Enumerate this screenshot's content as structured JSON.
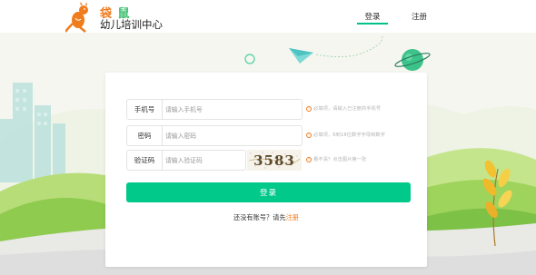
{
  "header": {
    "brand_a": "袋",
    "brand_b": "鼠",
    "subtitle": "幼儿培训中心",
    "nav": {
      "login": "登录",
      "register": "注册"
    }
  },
  "form": {
    "phone": {
      "label": "手机号",
      "placeholder": "请输入手机号",
      "hint": "必填项，请输入已注册的手机号"
    },
    "password": {
      "label": "密码",
      "placeholder": "请输入密码",
      "hint": "必填项，6到18位数字字母和数字"
    },
    "code": {
      "label": "验证码",
      "placeholder": "请输入验证码",
      "captcha_text": "3583",
      "hint": "看不清？点击图片换一张"
    },
    "submit_label": "登录",
    "footer_text": "还没有账号？请先",
    "footer_link": "注册"
  },
  "colors": {
    "primary": "#00c98a",
    "accent": "#f07c1e",
    "sky": "#f7f7f2"
  },
  "icons": {
    "warning": "exclamation-circle-icon"
  }
}
